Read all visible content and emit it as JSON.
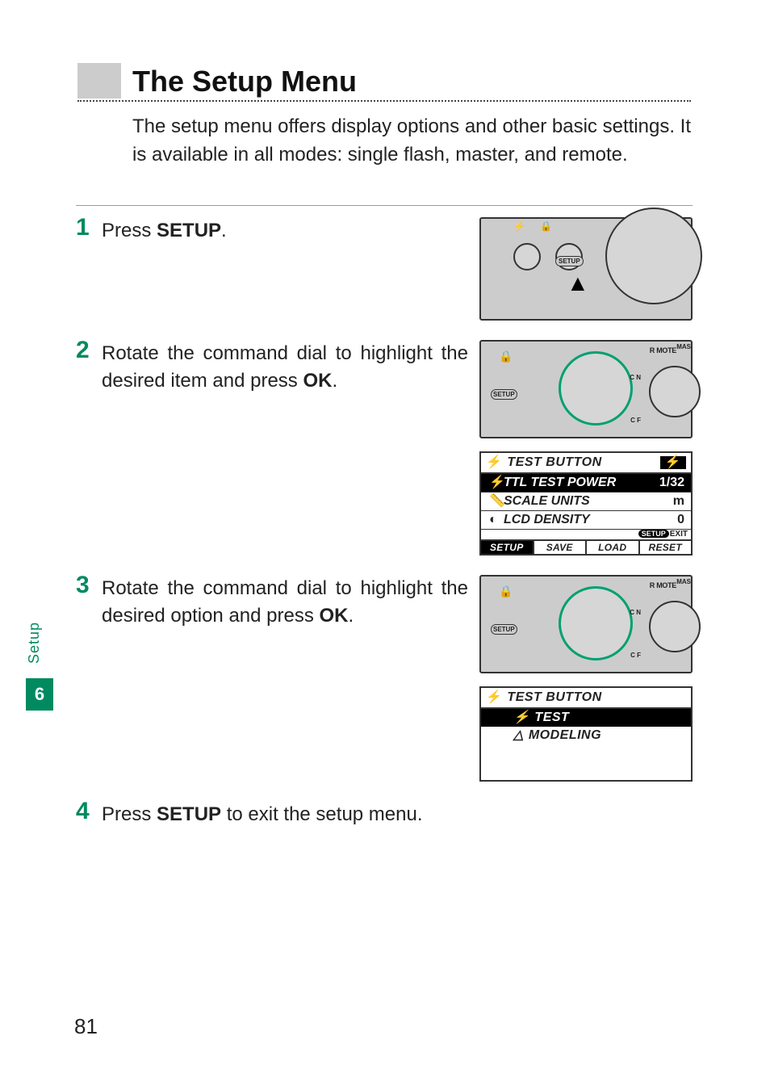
{
  "sidebar": {
    "section": "Setup",
    "chapter": "6"
  },
  "heading": "The Setup Menu",
  "intro": "The setup menu offers display options and other basic settings. It is available in all modes: single flash, master, and remote.",
  "steps": {
    "s1": {
      "num": "1",
      "pre": "Press ",
      "bold": "SETUP",
      "post": "."
    },
    "s2": {
      "num": "2",
      "pre": "Rotate the command dial to highlight the desired item and press ",
      "bold": "OK",
      "post": "."
    },
    "s3": {
      "num": "3",
      "pre": "Rotate the command dial to highlight the desired option and press ",
      "bold": "OK",
      "post": "."
    },
    "s4": {
      "num": "4",
      "pre": "Press ",
      "bold": "SETUP",
      "post": " to exit the setup menu."
    }
  },
  "device": {
    "setup": "SETUP",
    "remote": "R MOTE",
    "mas": "MAS",
    "on": "C N",
    "off": "C F"
  },
  "lcd1": {
    "flash": "⚡",
    "title": "TEST BUTTON",
    "tflash": "⚡",
    "r1": {
      "ic": "⚡",
      "lab": "TTL TEST POWER",
      "val": "1/32"
    },
    "r2": {
      "ic": "📏",
      "lab": "SCALE UNITS",
      "val": "m"
    },
    "r3": {
      "ic": "◐",
      "lab": "LCD DENSITY",
      "val": "0"
    },
    "exit_pill": "SETUP",
    "exit": "EXIT",
    "foot": [
      "SETUP",
      "SAVE",
      "LOAD",
      "RESET"
    ]
  },
  "lcd2": {
    "flash": "⚡",
    "title": "TEST BUTTON",
    "o1": {
      "ic": "⚡",
      "lab": "TEST"
    },
    "o2": {
      "ic": "△",
      "lab": "MODELING"
    }
  },
  "page": "81"
}
